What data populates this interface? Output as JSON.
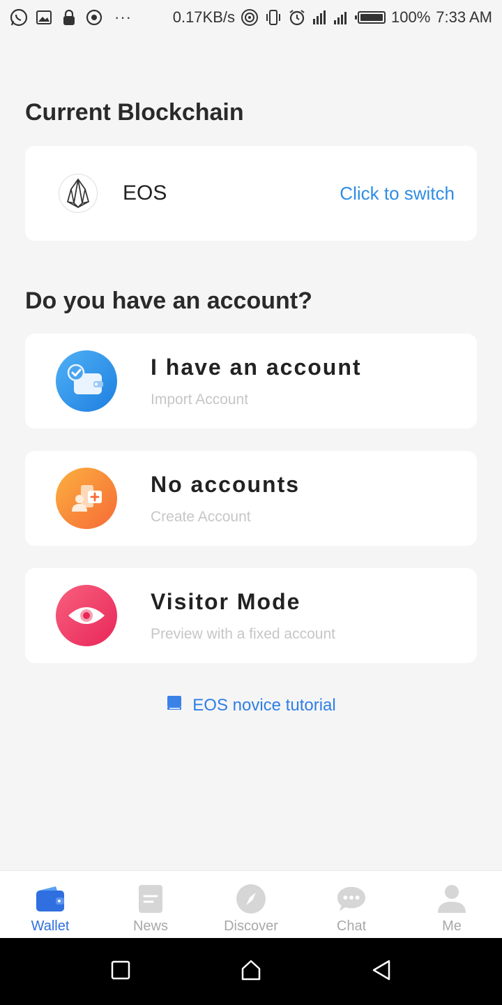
{
  "status_bar": {
    "network_speed": "0.17KB/s",
    "battery": "100%",
    "time": "7:33 AM",
    "icons": [
      "whatsapp-icon",
      "gallery-icon",
      "lock-icon",
      "record-icon",
      "more-icon",
      "hotspot-icon",
      "vibrate-icon",
      "alarm-icon",
      "signal-icon",
      "battery-icon"
    ]
  },
  "blockchain": {
    "heading": "Current Blockchain",
    "chain_name": "EOS",
    "switch_label": "Click to switch"
  },
  "account": {
    "heading": "Do you have an account?",
    "options": [
      {
        "title": "I have an account",
        "subtitle": "Import Account",
        "icon": "wallet-check-icon",
        "color": "#2f8de4"
      },
      {
        "title": "No accounts",
        "subtitle": "Create Account",
        "icon": "add-account-icon",
        "color": "#f7863a"
      },
      {
        "title": "Visitor Mode",
        "subtitle": "Preview with a fixed account",
        "icon": "eye-icon",
        "color": "#ee3d6a"
      }
    ]
  },
  "tutorial": {
    "label": "EOS novice tutorial"
  },
  "tabbar": {
    "tabs": [
      {
        "label": "Wallet",
        "active": true
      },
      {
        "label": "News",
        "active": false
      },
      {
        "label": "Discover",
        "active": false
      },
      {
        "label": "Chat",
        "active": false
      },
      {
        "label": "Me",
        "active": false
      }
    ]
  },
  "colors": {
    "accent": "#2f8de4",
    "tab_active": "#2f6fe0",
    "tab_inactive": "#a8a8a8",
    "background": "#f5f5f5"
  }
}
